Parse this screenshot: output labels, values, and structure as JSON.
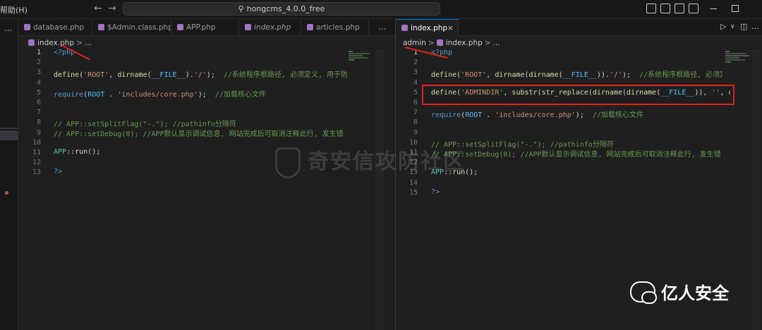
{
  "titlebar": {
    "menu_help": "帮助(H)",
    "back_icon": "←",
    "forward_icon": "→",
    "search_label": "hongcms_4.0.0_free"
  },
  "activity": {
    "ellipsis": "..."
  },
  "left_editor": {
    "tabs": [
      {
        "label": "database.php",
        "italic": false,
        "active": false
      },
      {
        "label": "$Admin.class.php",
        "italic": false,
        "active": false
      },
      {
        "label": "APP.php",
        "italic": false,
        "active": false
      },
      {
        "label": "index.php",
        "italic": true,
        "active": false
      },
      {
        "label": "articles.php",
        "italic": false,
        "active": false
      }
    ],
    "more": "...",
    "breadcrumb": {
      "file": "index.php",
      "sep": ">",
      "rest": "..."
    },
    "line_numbers": [
      "1",
      "2",
      "3",
      "4",
      "5",
      "6",
      "7",
      "8",
      "9",
      "10",
      "11",
      "12",
      "13"
    ],
    "current_line": "1"
  },
  "right_editor": {
    "tab": {
      "label": "index.php",
      "close": "×"
    },
    "actions": {
      "run": "▷",
      "dropdown": "∨",
      "split": "◫",
      "more": "..."
    },
    "breadcrumb": {
      "folder": "admin",
      "sep1": ">",
      "file": "index.php",
      "sep2": ">",
      "rest": "..."
    },
    "line_numbers": [
      "1",
      "2",
      "3",
      "4",
      "5",
      "6",
      "7",
      "8",
      "9",
      "10",
      "11",
      "12",
      "13",
      "14",
      "15"
    ],
    "current_line": "1"
  },
  "code": {
    "php_open": "<?php",
    "php_close": "?>",
    "define": "define",
    "dirname": "dirname",
    "root_const": "'ROOT'",
    "file_const": "__FILE__",
    "slash_str": "'/'",
    "comment_root_left": "//系统程序根路径, 必须定义, 用于防",
    "comment_root_right": "//系统程序根路径, 必须定义",
    "require_kw": "require",
    "root_word": "ROOT",
    "core_path": "'includes/core.php'",
    "comment_core": "//加载核心文件",
    "adminpath_const": "'ADMINDIR'",
    "substr_fn": "substr",
    "str_replace_fn": "str_replace",
    "empty_str": "''",
    "trail_di": "di",
    "comment_split": "// APP::setSplitFlag(\"-.\"); //pathinfo分隔符",
    "comment_debug": "// APP::setDebug(0); //APP默认显示调试信息, 网站完成后可取消注释此行, 发生错",
    "app_class": "APP",
    "run_fn": "run"
  },
  "watermark": "奇安信攻防社区",
  "brand": "亿人安全",
  "colors": {
    "accent": "#0078d4",
    "annotation_red": "#e02020",
    "php_purple": "#a074c4"
  }
}
